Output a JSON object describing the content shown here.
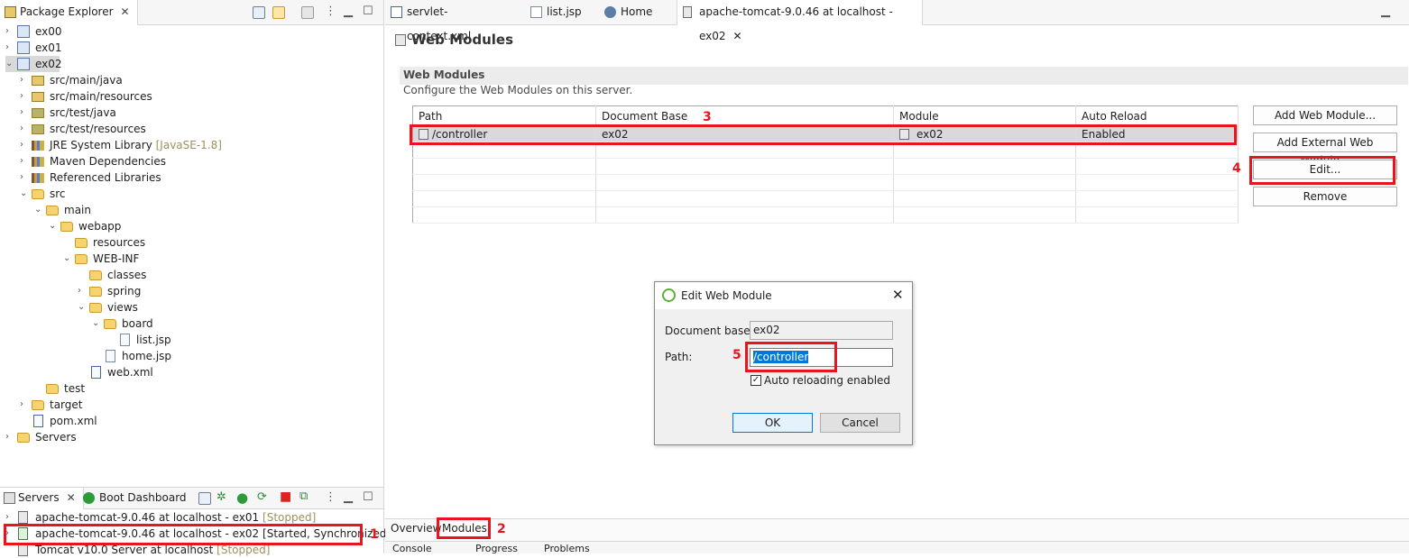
{
  "package_explorer": {
    "tab_label": "Package Explorer",
    "tree": [
      {
        "label": "ex00"
      },
      {
        "label": "ex01"
      },
      {
        "label": "ex02"
      },
      {
        "label": "src/main/java"
      },
      {
        "label": "src/main/resources"
      },
      {
        "label": "src/test/java"
      },
      {
        "label": "src/test/resources"
      },
      {
        "label": "JRE System Library",
        "suffix": "[JavaSE-1.8]"
      },
      {
        "label": "Maven Dependencies"
      },
      {
        "label": "Referenced Libraries"
      },
      {
        "label": "src"
      },
      {
        "label": "main"
      },
      {
        "label": "webapp"
      },
      {
        "label": "resources"
      },
      {
        "label": "WEB-INF"
      },
      {
        "label": "classes"
      },
      {
        "label": "spring"
      },
      {
        "label": "views"
      },
      {
        "label": "board"
      },
      {
        "label": "list.jsp"
      },
      {
        "label": "home.jsp"
      },
      {
        "label": "web.xml"
      },
      {
        "label": "test"
      },
      {
        "label": "target"
      },
      {
        "label": "pom.xml"
      },
      {
        "label": "Servers"
      }
    ]
  },
  "servers_view": {
    "tab_label": "Servers",
    "tab2_label": "Boot Dashboard",
    "items": [
      {
        "name": "apache-tomcat-9.0.46 at localhost - ex01",
        "status": "[Stopped]"
      },
      {
        "name": "apache-tomcat-9.0.46 at localhost - ex02",
        "status": "[Started, Synchronized]"
      },
      {
        "name": "Tomcat v10.0 Server at localhost",
        "status": "[Stopped]"
      }
    ]
  },
  "editor": {
    "tabs": [
      {
        "label": "servlet-context.xml"
      },
      {
        "label": "list.jsp"
      },
      {
        "label": "Home"
      },
      {
        "label": "apache-tomcat-9.0.46 at localhost - ex02"
      }
    ],
    "page_title": "Web Modules",
    "section_title": "Web Modules",
    "section_desc": "Configure the Web Modules on this server.",
    "table": {
      "headers": [
        "Path",
        "Document Base",
        "Module",
        "Auto Reload"
      ],
      "row": {
        "path": "/controller",
        "doc_base": "ex02",
        "module": "ex02",
        "auto_reload": "Enabled"
      }
    },
    "buttons": {
      "add": "Add Web Module...",
      "add_external": "Add External Web Module...",
      "edit": "Edit...",
      "remove": "Remove"
    },
    "bottom_tabs": {
      "overview": "Overview",
      "modules": "Modules"
    }
  },
  "dialog": {
    "title": "Edit Web Module",
    "doc_base_label": "Document base:",
    "doc_base_value": "ex02",
    "path_label": "Path:",
    "path_value": "/controller",
    "auto_reload_label": "Auto reloading enabled",
    "ok": "OK",
    "cancel": "Cancel"
  },
  "console_tabs": {
    "console": "Console",
    "progress": "Progress",
    "problems": "Problems"
  },
  "annotations": {
    "n1": "1",
    "n2": "2",
    "n3": "3",
    "n4": "4",
    "n5": "5"
  },
  "colors": {
    "annotation_red": "#e8141e",
    "selection": "#d9d9d9",
    "highlight": "#0078d7"
  }
}
